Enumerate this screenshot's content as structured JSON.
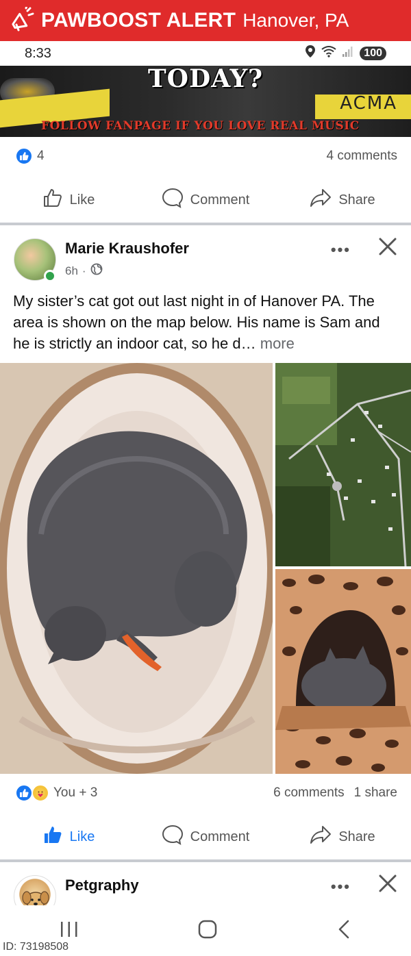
{
  "alert": {
    "brand": "PAWBOOST ALERT",
    "location": "Hanover, PA",
    "icon": "megaphone-icon"
  },
  "status_bar": {
    "time": "8:33",
    "battery": "100",
    "icons": [
      "location-icon",
      "wifi-icon",
      "signal-icon"
    ]
  },
  "prev_post": {
    "image_text": {
      "headline": "TODAY?",
      "watermark": "ACMA",
      "banner": "FOLLOW FANPAGE IF YOU LOVE REAL MUSIC"
    },
    "reactions_count": "4",
    "comments": "4 comments",
    "actions": {
      "like": "Like",
      "comment": "Comment",
      "share": "Share"
    }
  },
  "post": {
    "author": "Marie Kraushofer",
    "time": "6h",
    "privacy_icon": "globe-icon",
    "text": "My sister’s cat got out last night in of Hanover PA. The area is shown on the map below. His name is Sam and he is strictly an indoor cat, so he d…",
    "more_label": "more",
    "reactions": "You + 3",
    "comments": "6 comments",
    "shares": "1 share",
    "actions": {
      "like": "Like",
      "comment": "Comment",
      "share": "Share"
    }
  },
  "next_post": {
    "author": "Petgraphy"
  },
  "footer": {
    "id_label": "ID: 73198508"
  },
  "colors": {
    "alert_red": "#e02b2b",
    "fb_blue": "#1877f2",
    "online_green": "#31a24c"
  }
}
